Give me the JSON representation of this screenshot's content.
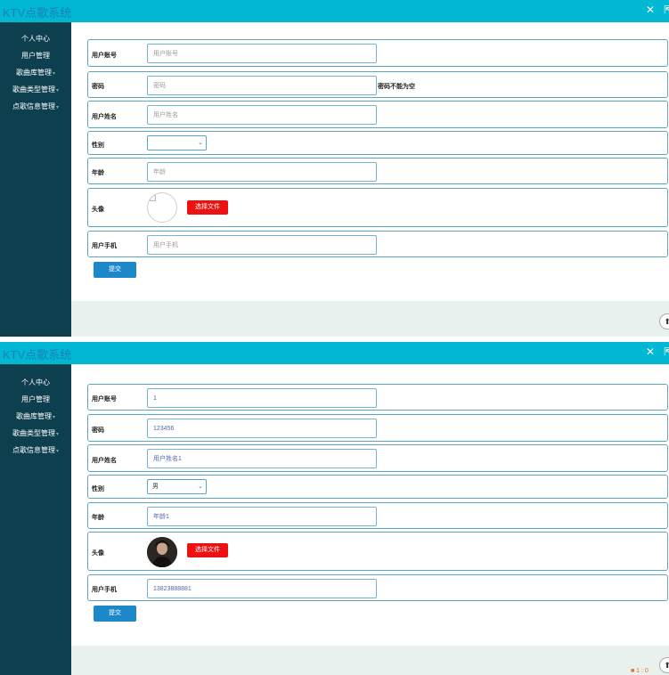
{
  "app": {
    "title": "KTV点歌系统",
    "close_glyph": "✕",
    "edge_glyph": "⇱",
    "scroll_top_glyph": "⬆",
    "status_badge": "■ 1 : 0"
  },
  "sidebar": {
    "items": [
      {
        "label": "个人中心"
      },
      {
        "label": "用户管理"
      },
      {
        "label": "歌曲库管理"
      },
      {
        "label": "歌曲类型管理"
      },
      {
        "label": "点歌信息管理"
      }
    ],
    "caret": "▾"
  },
  "form": {
    "account_label": "用户账号",
    "account_placeholder": "用户账号",
    "password_label": "密码",
    "password_placeholder": "密码",
    "password_hint": "密码不能为空",
    "name_label": "用户姓名",
    "name_placeholder": "用户姓名",
    "gender_label": "性别",
    "age_label": "年龄",
    "age_placeholder": "年龄",
    "avatar_label": "头像",
    "choose_file_label": "选择文件",
    "phone_label": "用户手机",
    "phone_placeholder": "用户手机",
    "submit_label": "提交",
    "select_chevron": "⌄"
  },
  "filled": {
    "account": "1",
    "password": "123456",
    "name": "用户姓名1",
    "gender": "男",
    "age": "年龄1",
    "phone": "13823888881"
  },
  "colors": {
    "header": "#00b8d4",
    "sidebar": "#0d3f4f",
    "submit": "#1c87c9",
    "choose_file": "#ee1111",
    "row_border": "#5ba4c7",
    "footer_band": "#e8f1ee"
  }
}
